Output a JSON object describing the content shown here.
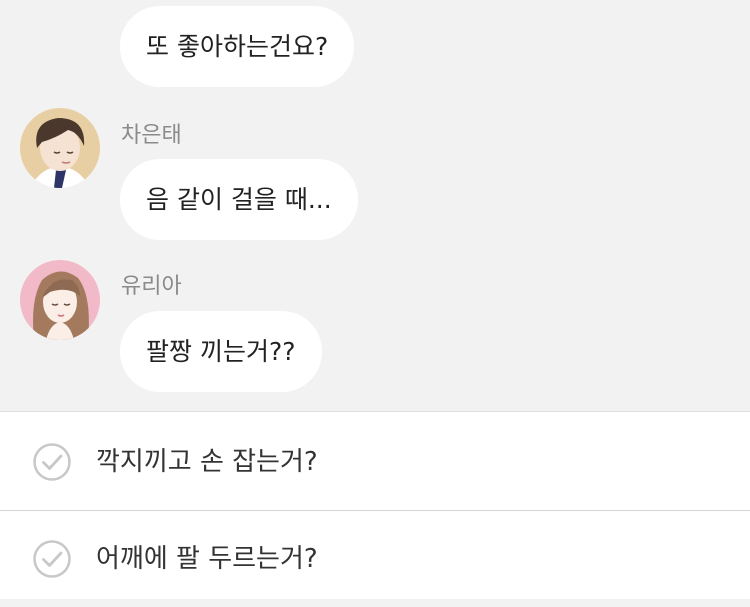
{
  "messages": [
    {
      "text": "또 좋아하는건요?"
    },
    {
      "sender": "차은태",
      "text": "음 같이 걸을 때..."
    },
    {
      "sender": "유리아",
      "text": "팔짱 끼는거??"
    }
  ],
  "choices": [
    {
      "label": "깍지끼고 손 잡는거?"
    },
    {
      "label": "어깨에 팔 두르는거?"
    }
  ],
  "colors": {
    "background": "#f2f2f2",
    "bubble": "#ffffff",
    "sender_name": "#8a8a8a",
    "check_icon": "#c8c8c8"
  }
}
